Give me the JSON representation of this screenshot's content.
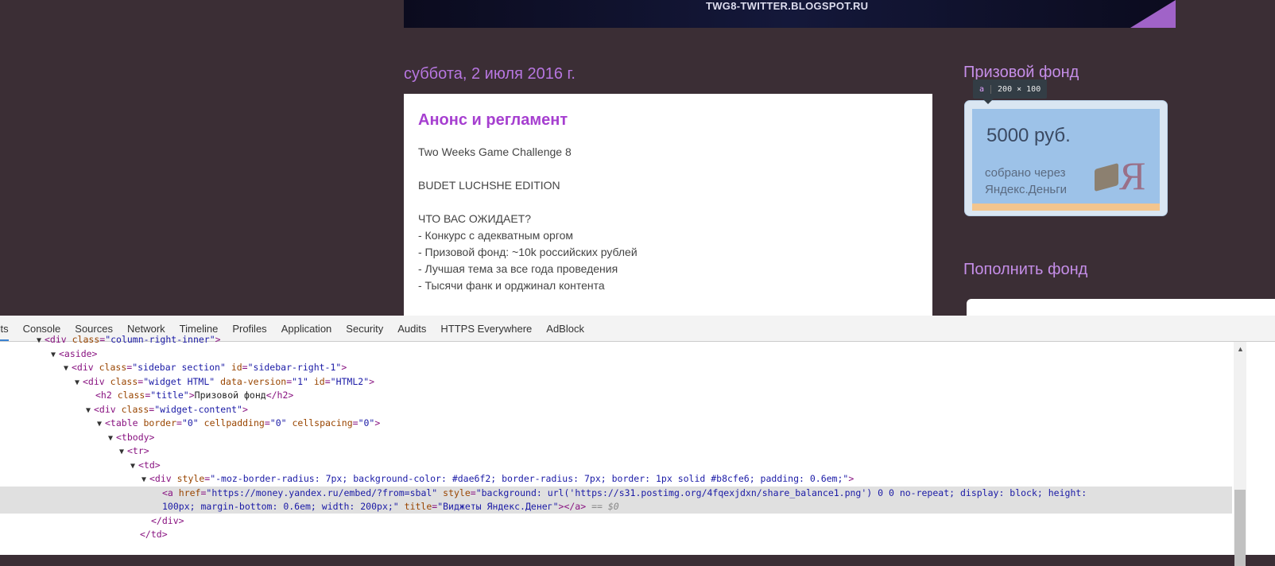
{
  "banner": {
    "url": "TWG8-TWITTER.BLOGSPOT.RU"
  },
  "post": {
    "date": "суббота, 2 июля 2016 г.",
    "title": "Анонс и регламент",
    "lines": [
      "Two Weeks Game Challenge 8",
      "",
      "BUDET LUCHSHE EDITION",
      "",
      "ЧТО ВАС ОЖИДАЕТ?",
      "- Конкурс с адекватным оргом",
      "- Призовой фонд: ~10k российских рублей",
      "- Лучшая тема за все года проведения",
      "- Тысячи фанк и орджинал контента"
    ]
  },
  "sidebar": {
    "prize_title": "Призовой фонд",
    "widget": {
      "amount": "5000 руб.",
      "sub1": "собрано через",
      "sub2": "Яндекс.Деньги",
      "logo": "Я"
    },
    "tooltip": {
      "tag": "a",
      "size": "200 × 100"
    },
    "topup_title": "Пополнить фонд"
  },
  "devtools": {
    "tabs": [
      "ents",
      "Console",
      "Sources",
      "Network",
      "Timeline",
      "Profiles",
      "Application",
      "Security",
      "Audits",
      "HTTPS Everywhere",
      "AdBlock"
    ],
    "lines": [
      {
        "tri": "▼",
        "tok": [
          [
            "tag",
            "<div "
          ],
          [
            "an",
            "class"
          ],
          [
            "tag",
            "="
          ],
          [
            "av",
            "\"column-right-inner\""
          ],
          [
            "tag",
            ">"
          ]
        ]
      },
      {
        "tri": "▼",
        "tok": [
          [
            "tag",
            "<aside>"
          ]
        ]
      },
      {
        "tri": "▼",
        "tok": [
          [
            "tag",
            "<div "
          ],
          [
            "an",
            "class"
          ],
          [
            "tag",
            "="
          ],
          [
            "av",
            "\"sidebar section\""
          ],
          [
            "an",
            " id"
          ],
          [
            "tag",
            "="
          ],
          [
            "av",
            "\"sidebar-right-1\""
          ],
          [
            "tag",
            ">"
          ]
        ]
      },
      {
        "tri": "▼",
        "tok": [
          [
            "tag",
            "<div "
          ],
          [
            "an",
            "class"
          ],
          [
            "tag",
            "="
          ],
          [
            "av",
            "\"widget HTML\""
          ],
          [
            "an",
            " data-version"
          ],
          [
            "tag",
            "="
          ],
          [
            "av",
            "\"1\""
          ],
          [
            "an",
            " id"
          ],
          [
            "tag",
            "="
          ],
          [
            "av",
            "\"HTML2\""
          ],
          [
            "tag",
            ">"
          ]
        ]
      },
      {
        "tri": "",
        "tok": [
          [
            "tag",
            "<h2 "
          ],
          [
            "an",
            "class"
          ],
          [
            "tag",
            "="
          ],
          [
            "av",
            "\"title\""
          ],
          [
            "tag",
            ">"
          ],
          [
            "tx",
            "Призовой фонд"
          ],
          [
            "tag",
            "</h2>"
          ]
        ]
      },
      {
        "tri": "▼",
        "tok": [
          [
            "tag",
            "<div "
          ],
          [
            "an",
            "class"
          ],
          [
            "tag",
            "="
          ],
          [
            "av",
            "\"widget-content\""
          ],
          [
            "tag",
            ">"
          ]
        ]
      },
      {
        "tri": "▼",
        "tok": [
          [
            "tag",
            "<table "
          ],
          [
            "an",
            "border"
          ],
          [
            "tag",
            "="
          ],
          [
            "av",
            "\"0\""
          ],
          [
            "an",
            " cellpadding"
          ],
          [
            "tag",
            "="
          ],
          [
            "av",
            "\"0\""
          ],
          [
            "an",
            " cellspacing"
          ],
          [
            "tag",
            "="
          ],
          [
            "av",
            "\"0\""
          ],
          [
            "tag",
            ">"
          ]
        ]
      },
      {
        "tri": "▼",
        "tok": [
          [
            "tag",
            "<tbody>"
          ]
        ]
      },
      {
        "tri": "▼",
        "tok": [
          [
            "tag",
            "<tr>"
          ]
        ]
      },
      {
        "tri": "▼",
        "tok": [
          [
            "tag",
            "<td>"
          ]
        ]
      },
      {
        "tri": "▼",
        "tok": [
          [
            "tag",
            "<div "
          ],
          [
            "an",
            "style"
          ],
          [
            "tag",
            "="
          ],
          [
            "av",
            "\"-moz-border-radius: 7px; background-color: #dae6f2; border-radius: 7px; border: 1px solid #b8cfe6; padding: 0.6em;\""
          ],
          [
            "tag",
            ">"
          ]
        ]
      },
      {
        "tri": "",
        "tok": [
          [
            "tag",
            "<a "
          ],
          [
            "an",
            "href"
          ],
          [
            "tag",
            "="
          ],
          [
            "av",
            "\"https://money.yandex.ru/embed/?from=sbal\""
          ],
          [
            "an",
            " style"
          ],
          [
            "tag",
            "="
          ],
          [
            "av",
            "\"background: url('https://s31.postimg.org/4fqexjdxn/share_balance1.png') 0 0 no-repeat; display: block; height:"
          ]
        ]
      },
      {
        "tri": "",
        "tok": [
          [
            "av",
            "100px; margin-bottom: 0.6em; width: 200px;\""
          ],
          [
            "an",
            " title"
          ],
          [
            "tag",
            "="
          ],
          [
            "av",
            "\"Виджеты Яндекс.Денег\""
          ],
          [
            "tag",
            "></a>"
          ],
          [
            "dim",
            " == $0"
          ]
        ]
      },
      {
        "tri": "",
        "tok": [
          [
            "tag",
            "</div>"
          ]
        ]
      },
      {
        "tri": "",
        "tok": [
          [
            "tag",
            "</td>"
          ]
        ]
      }
    ]
  }
}
